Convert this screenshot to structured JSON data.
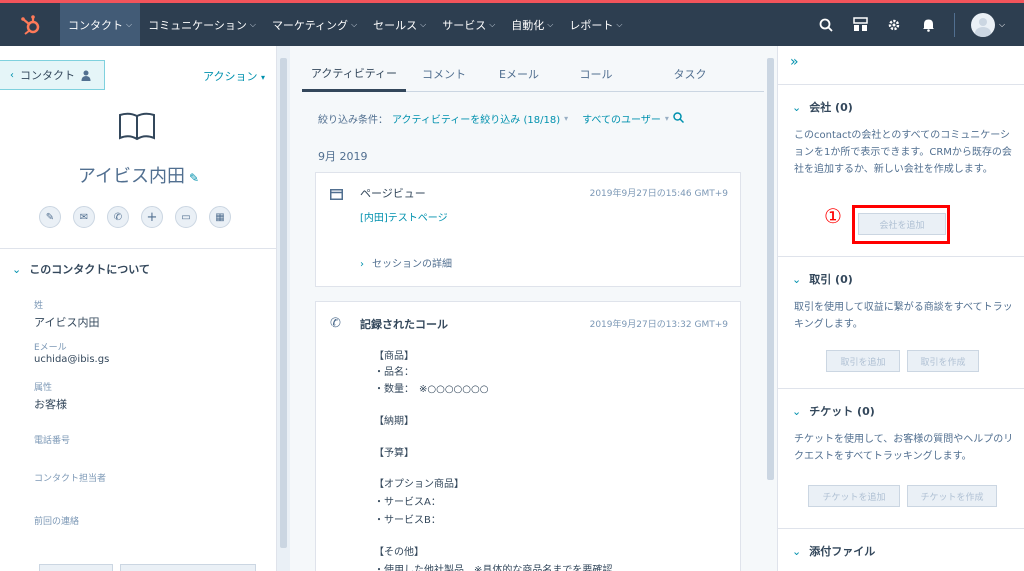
{
  "nav": {
    "items": [
      "コンタクト",
      "コミュニケーション",
      "マーケティング",
      "セールス",
      "サービス",
      "自動化",
      "レポート"
    ],
    "active": 0
  },
  "left": {
    "back_label": "コンタクト",
    "actions_label": "アクション",
    "contact_name": "アイビス内田",
    "about_title": "このコンタクトについて",
    "properties": [
      {
        "label": "姓",
        "value": "アイビス内田"
      },
      {
        "label": "Eメール",
        "value": "uchida@ibis.gs"
      },
      {
        "label": "属性",
        "value": "お客様"
      },
      {
        "label": "電話番号",
        "value": ""
      },
      {
        "label": "コンタクト担当者",
        "value": ""
      },
      {
        "label": "前回の連絡",
        "value": ""
      }
    ]
  },
  "middle": {
    "tabs": [
      "アクティビティー",
      "コメント",
      "Eメール",
      "コール",
      "タスク"
    ],
    "filter_label": "絞り込み条件：",
    "filter_value": "アクティビティーを絞り込み (18/18)",
    "users_value": "すべてのユーザー",
    "month": "9月 2019",
    "pageview": {
      "title": "ページビュー",
      "timestamp": "2019年9月27日の15:46 GMT+9",
      "link": "[内田]テストページ",
      "session": "セッションの詳細"
    },
    "call": {
      "title": "記録されたコール",
      "timestamp": "2019年9月27日の13:32 GMT+9",
      "lines": [
        "【商品】",
        "・品名：",
        "・数量：　※○○○○○○○",
        "【納期】",
        "【予算】",
        "【オプション商品】",
        "・サービスA：",
        "・サービスB：",
        "【その他】",
        "・使用した他社製品　※具体的な商品名までを要確認"
      ]
    }
  },
  "right": {
    "company": {
      "title": "会社 (0)",
      "desc": "このcontactの会社とのすべてのコミュニケーションを1か所で表示できます。CRMから既存の会社を追加するか、新しい会社を作成します。",
      "add_label": "会社を追加"
    },
    "deal": {
      "title": "取引 (0)",
      "desc": "取引を使用して収益に繋がる商談をすべてトラッキングします。",
      "add_label": "取引を追加",
      "create_label": "取引を作成"
    },
    "ticket": {
      "title": "チケット (0)",
      "desc": "チケットを使用して、お客様の質問やヘルプのリクエストをすべてトラッキングします。",
      "add_label": "チケットを追加",
      "create_label": "チケットを作成"
    },
    "attach": {
      "title": "添付ファイル"
    }
  },
  "annotation": {
    "marker": "①",
    "color": "#ff0000"
  },
  "colors": {
    "nav_bg": "#2d3e50",
    "accent": "#0091ae",
    "hubspot_orange": "#ff7a59"
  }
}
